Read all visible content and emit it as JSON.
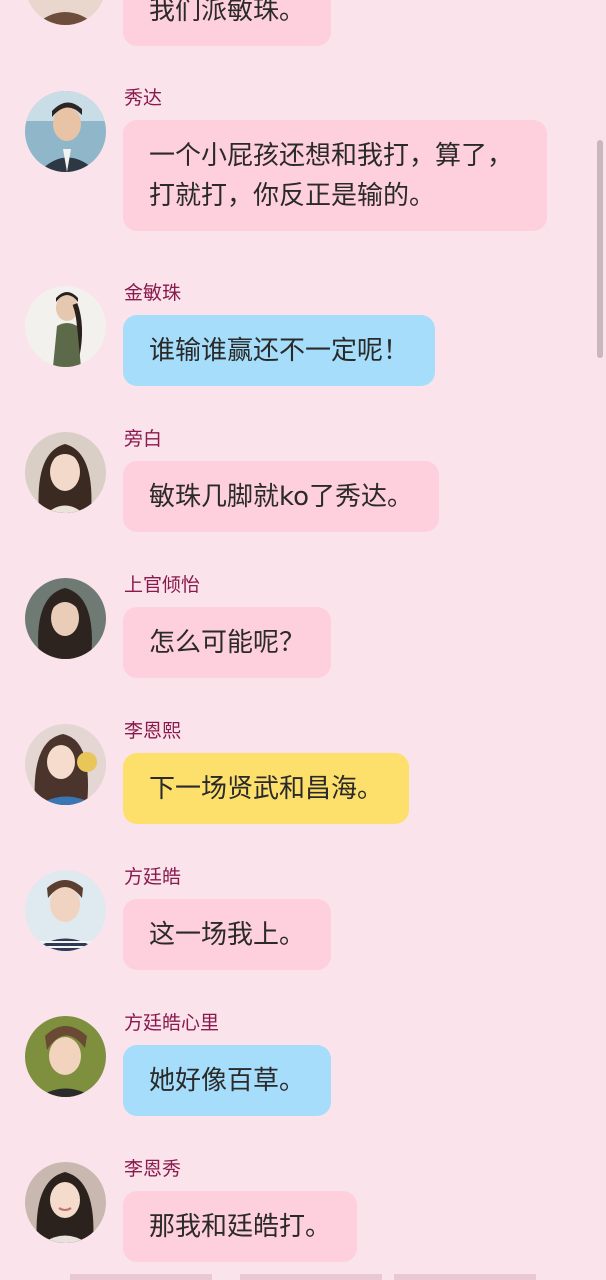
{
  "colors": {
    "background": "#fae3ea",
    "name": "#8a1a4e",
    "bubble_pink": "#fecfdc",
    "bubble_blue": "#a6ddfa",
    "bubble_yellow": "#fddf6c"
  },
  "messages": [
    {
      "name": "",
      "text": "我们派敏珠。",
      "color": "pink",
      "avatar": "female-avatar-partial"
    },
    {
      "name": "秀达",
      "text": "一个小屁孩还想和我打，算了，打就打，你反正是输的。",
      "color": "pink",
      "avatar": "male-avatar-suit"
    },
    {
      "name": "金敏珠",
      "text": "谁输谁赢还不一定呢！",
      "color": "blue",
      "avatar": "female-avatar-braid"
    },
    {
      "name": "旁白",
      "text": "敏珠几脚就ko了秀达。",
      "color": "pink",
      "avatar": "female-avatar-longhair"
    },
    {
      "name": "上官倾怡",
      "text": "怎么可能呢？",
      "color": "pink",
      "avatar": "female-avatar-dark"
    },
    {
      "name": "李恩熙",
      "text": "下一场贤武和昌海。",
      "color": "yellow",
      "avatar": "female-avatar-toy"
    },
    {
      "name": "方廷皓",
      "text": "这一场我上。",
      "color": "pink",
      "avatar": "male-avatar-striped"
    },
    {
      "name": "方廷皓心里",
      "text": "她好像百草。",
      "color": "blue",
      "avatar": "male-avatar-green"
    },
    {
      "name": "李恩秀",
      "text": "那我和廷皓打。",
      "color": "pink",
      "avatar": "female-avatar-smile"
    }
  ]
}
